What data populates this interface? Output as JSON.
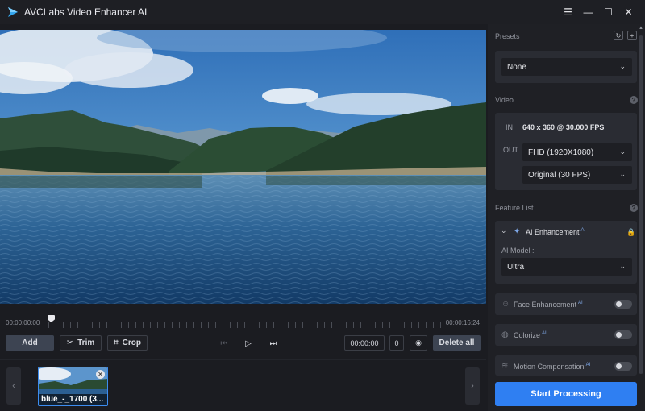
{
  "window": {
    "title": "AVCLabs Video Enhancer AI",
    "controls": [
      "menu-icon",
      "minimize-icon",
      "maximize-icon",
      "close-icon"
    ]
  },
  "timeline": {
    "start_time": "00:00:00:00",
    "end_time": "00:00:16:24"
  },
  "toolbar": {
    "add_label": "Add",
    "trim_label": "Trim",
    "crop_label": "Crop",
    "timecode": "00:00:00",
    "frame_value": "0",
    "delete_all_label": "Delete all"
  },
  "clips": [
    {
      "label": "blue_-_1700 (3..."
    }
  ],
  "panel": {
    "presets": {
      "title": "Presets",
      "selected": "None"
    },
    "video": {
      "title": "Video",
      "in_label": "IN",
      "in_value": "640 x 360 @ 30.000 FPS",
      "out_label": "OUT",
      "resolution": "FHD (1920X1080)",
      "framerate": "Original (30 FPS)"
    },
    "feature_list": {
      "title": "Feature List",
      "ai_enhancement": {
        "label": "AI Enhancement",
        "badge": "AI",
        "model_label": "AI Model :",
        "model_value": "Ultra"
      },
      "features": [
        {
          "label": "Face Enhancement",
          "badge": "AI",
          "enabled": false,
          "icon": "face-icon"
        },
        {
          "label": "Colorize",
          "badge": "AI",
          "enabled": false,
          "icon": "palette-icon"
        },
        {
          "label": "Motion Compensation",
          "badge": "AI",
          "enabled": false,
          "icon": "motion-icon"
        }
      ]
    },
    "start_label": "Start Processing"
  },
  "colors": {
    "accent": "#2f7ff2",
    "background": "#1b1c21",
    "panel": "#1f2025",
    "card": "#2a2c33"
  }
}
